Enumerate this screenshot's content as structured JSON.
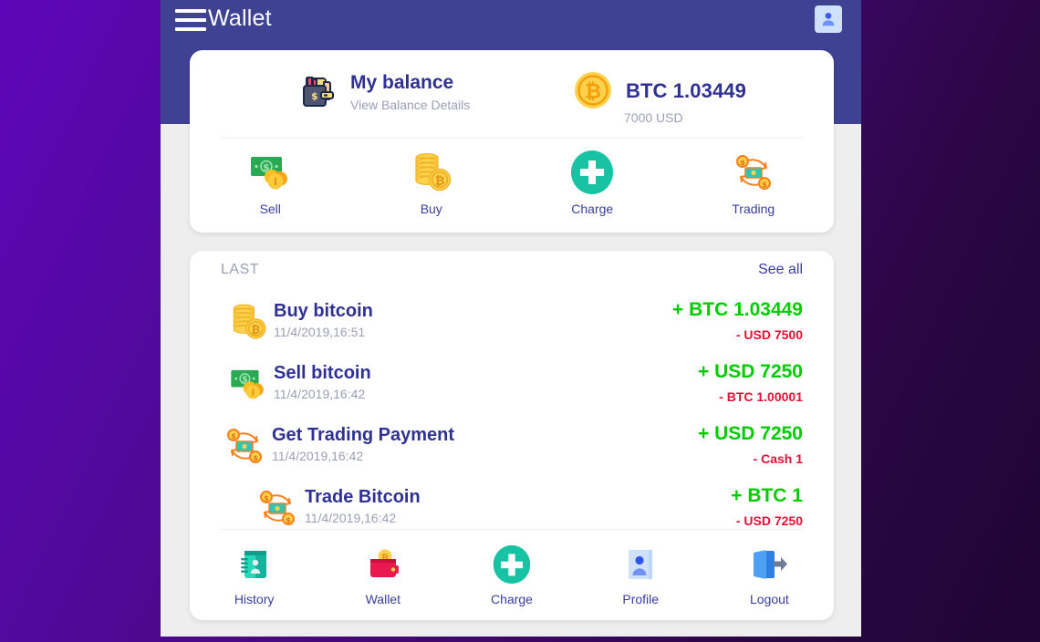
{
  "theme": {
    "background_gradient_from": "#5d06b8",
    "background_gradient_to": "#1f0533",
    "appbar_bg": "#3f4193",
    "app_bg": "#eeeeee",
    "card_bg": "#ffffff",
    "primary_text": "#2f3192",
    "muted_text": "#9aa0b5",
    "positive": "#00cc00",
    "negative": "#e11236",
    "accent_teal": "#17c3a2",
    "link": "#3a3d9e"
  },
  "appbar": {
    "title": "Wallet",
    "menu_icon": "hamburger-menu-icon",
    "avatar_icon": "user-avatar-icon"
  },
  "balance": {
    "icon": "wallet-icon",
    "title": "My balance",
    "subtitle": "View Balance Details",
    "coin_icon": "bitcoin-coin-icon",
    "btc_amount": "BTC 1.03449",
    "usd_amount": "7000 USD"
  },
  "actions": [
    {
      "label": "Sell",
      "icon": "sell-money-icon"
    },
    {
      "label": "Buy",
      "icon": "buy-coins-icon"
    },
    {
      "label": "Charge",
      "icon": "charge-plus-icon"
    },
    {
      "label": "Trading",
      "icon": "trading-exchange-icon"
    }
  ],
  "transactions": {
    "section_label": "LAST",
    "see_all_label": "See all",
    "rows": [
      {
        "icon": "buy-coins-icon",
        "name": "Buy bitcoin",
        "date": "11/4/2019,16:51",
        "credit": "+ BTC 1.03449",
        "debit": "- USD 7500"
      },
      {
        "icon": "sell-money-icon",
        "name": "Sell bitcoin",
        "date": "11/4/2019,16:42",
        "credit": "+ USD 7250",
        "debit": "- BTC 1.00001"
      },
      {
        "icon": "trading-exchange-icon",
        "name": "Get Trading Payment",
        "date": "11/4/2019,16:42",
        "credit": "+ USD 7250",
        "debit": "- Cash 1"
      },
      {
        "icon": "trading-exchange-icon",
        "name": "Trade Bitcoin",
        "date": "11/4/2019,16:42",
        "credit": "+ BTC 1",
        "debit": "- USD 7250"
      }
    ]
  },
  "bottom_nav": [
    {
      "label": "History",
      "icon": "history-book-icon"
    },
    {
      "label": "Wallet",
      "icon": "wallet-coin-icon"
    },
    {
      "label": "Charge",
      "icon": "charge-plus-icon"
    },
    {
      "label": "Profile",
      "icon": "profile-card-icon"
    },
    {
      "label": "Logout",
      "icon": "logout-arrow-icon"
    }
  ]
}
